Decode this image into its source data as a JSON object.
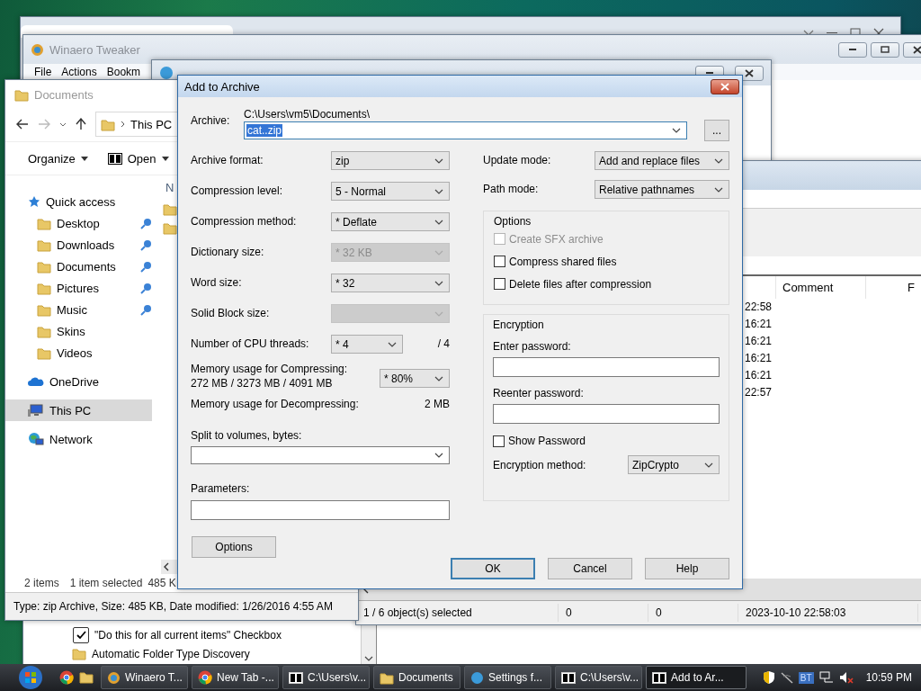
{
  "tweaker": {
    "title": "Winaero Tweaker",
    "menu": [
      "File",
      "Actions",
      "Bookm"
    ],
    "tree": [
      {
        "kind": "checkbox",
        "label": "\"Do this for all current items\" Checkbox",
        "checked": true
      },
      {
        "kind": "folder",
        "label": "Automatic Folder Type Discovery"
      }
    ]
  },
  "zip_manager": {
    "columns": [
      "Comment",
      "F"
    ],
    "rows": [
      "22:58",
      "16:21",
      "16:21",
      "16:21",
      "16:21",
      "22:57"
    ],
    "status": [
      "1 / 6 object(s) selected",
      "0",
      "0",
      "2023-10-10 22:58:03"
    ]
  },
  "explorer": {
    "title": "Documents",
    "breadcrumb": "This PC",
    "toolbar": [
      "Organize",
      "Open"
    ],
    "column": "N",
    "nav": [
      {
        "label": "Quick access",
        "kind": "star",
        "selected": false,
        "children": [
          {
            "label": "Desktop",
            "kind": "folder",
            "pinned": true,
            "selected": false
          },
          {
            "label": "Downloads",
            "kind": "folder",
            "pinned": true,
            "selected": false
          },
          {
            "label": "Documents",
            "kind": "folder",
            "pinned": true,
            "selected": false
          },
          {
            "label": "Pictures",
            "kind": "folder",
            "pinned": true,
            "selected": false
          },
          {
            "label": "Music",
            "kind": "folder",
            "pinned": true,
            "selected": false
          },
          {
            "label": "Skins",
            "kind": "folder",
            "pinned": false,
            "selected": false
          },
          {
            "label": "Videos",
            "kind": "folder",
            "pinned": false,
            "selected": false
          }
        ]
      },
      {
        "label": "OneDrive",
        "kind": "cloud",
        "selected": false
      },
      {
        "label": "This PC",
        "kind": "pc",
        "selected": true
      },
      {
        "label": "Network",
        "kind": "network",
        "selected": false
      }
    ],
    "status": [
      "2 items",
      "1 item selected",
      "485 K"
    ],
    "details": "Type: zip Archive, Size: 485 KB, Date modified: 1/26/2016 4:55 AM"
  },
  "dialog": {
    "title": "Add to Archive",
    "archive_label": "Archive:",
    "archive_path": "C:\\Users\\vm5\\Documents\\",
    "archive_name": "cat..zip",
    "highlighted": true,
    "browse": "...",
    "left": [
      {
        "kind": "select",
        "label": "Archive format:",
        "value": "zip",
        "disabled": false
      },
      {
        "kind": "select",
        "label": "Compression level:",
        "value": "5 - Normal",
        "disabled": false
      },
      {
        "kind": "select",
        "label": "Compression method:",
        "value": "* Deflate",
        "disabled": false
      },
      {
        "kind": "select",
        "label": "Dictionary size:",
        "value": "* 32 KB",
        "disabled": true
      },
      {
        "kind": "select",
        "label": "Word size:",
        "value": "* 32",
        "disabled": false
      },
      {
        "kind": "select",
        "label": "Solid Block size:",
        "disabled": true
      },
      {
        "kind": "threads",
        "label": "Number of CPU threads:",
        "value": "* 4",
        "suffix": "/ 4",
        "disabled": false
      },
      {
        "kind": "memory",
        "label": "Memory usage for Compressing:",
        "detail": "272 MB / 3273 MB / 4091 MB",
        "value": "* 80%",
        "disabled": false
      },
      {
        "kind": "info",
        "label": "Memory usage for Decompressing:",
        "detail": "2 MB"
      },
      {
        "kind": "combo",
        "label": "Split to volumes, bytes:"
      },
      {
        "kind": "input",
        "label": "Parameters:"
      }
    ],
    "options_button": "Options",
    "right": [
      {
        "label": "Update mode:",
        "value": "Add and replace files"
      },
      {
        "label": "Path mode:",
        "value": "Relative pathnames"
      }
    ],
    "options_group": {
      "title": "Options",
      "checkboxes": [
        {
          "label": "Create SFX archive",
          "checked": false,
          "disabled": true
        },
        {
          "label": "Compress shared files",
          "checked": false,
          "disabled": false
        },
        {
          "label": "Delete files after compression",
          "checked": false,
          "disabled": false
        }
      ]
    },
    "encryption": {
      "title": "Encryption",
      "password_label": "Enter password:",
      "reenter_label": "Reenter password:",
      "show_password": {
        "label": "Show Password",
        "checked": false
      },
      "method_label": "Encryption method:",
      "method": "ZipCrypto"
    },
    "buttons": [
      {
        "label": "OK",
        "default": true
      },
      {
        "label": "Cancel",
        "default": false
      },
      {
        "label": "Help",
        "default": false
      }
    ]
  },
  "taskbar": {
    "tasks": [
      {
        "kind": "winaero",
        "label": "Winaero T...",
        "selected": false
      },
      {
        "kind": "chrome",
        "label": "New Tab -...",
        "selected": false
      },
      {
        "kind": "archiver",
        "label": "C:\\Users\\v...",
        "selected": false
      },
      {
        "kind": "folder",
        "label": "Documents",
        "selected": false
      },
      {
        "kind": "settings",
        "label": "Settings f...",
        "selected": false
      },
      {
        "kind": "archiver",
        "label": "C:\\Users\\v...",
        "selected": false
      },
      {
        "kind": "archiver",
        "label": "Add to Ar...",
        "selected": true
      }
    ],
    "tray_badge": "BT",
    "clock": "10:59 PM"
  }
}
